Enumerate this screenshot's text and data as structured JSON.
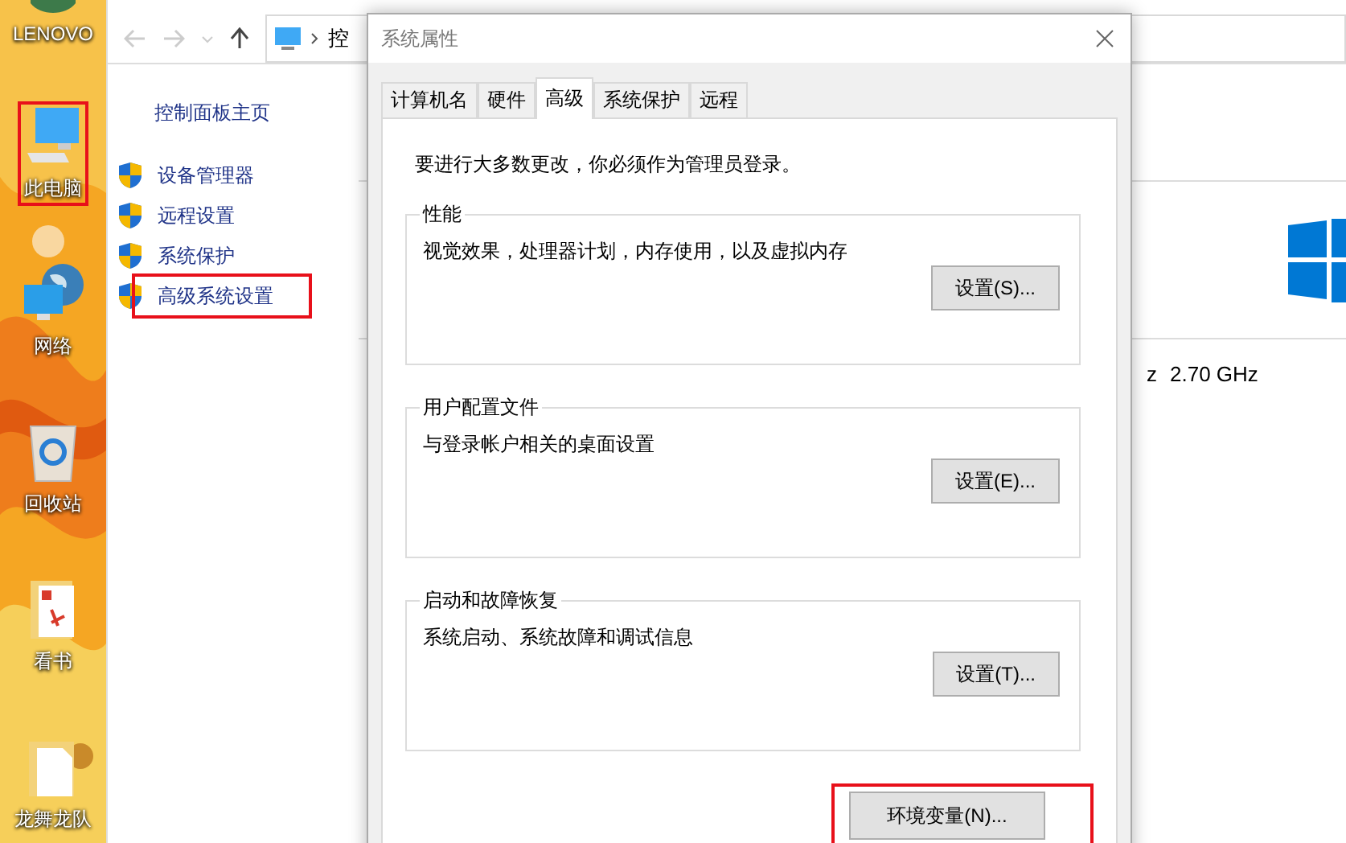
{
  "desktop": {
    "icons": [
      {
        "label": "LENOVO",
        "kind": "user",
        "highlighted": false
      },
      {
        "label": "此电脑",
        "kind": "computer",
        "highlighted": true
      },
      {
        "label": "网络",
        "kind": "network",
        "highlighted": false
      },
      {
        "label": "回收站",
        "kind": "recycle",
        "highlighted": false
      },
      {
        "label": "看书",
        "kind": "pdf",
        "highlighted": false
      },
      {
        "label": "龙舞龙队",
        "kind": "folder",
        "highlighted": false
      }
    ]
  },
  "explorer": {
    "address": "控",
    "nav_title": "控制面板主页",
    "nav_items": [
      {
        "label": "设备管理器",
        "highlighted": false
      },
      {
        "label": "远程设置",
        "highlighted": false
      },
      {
        "label": "系统保护",
        "highlighted": false
      },
      {
        "label": "高级系统设置",
        "highlighted": true
      }
    ],
    "processor_fragment": "z",
    "processor_speed": "2.70 GHz"
  },
  "dialog": {
    "title": "系统属性",
    "tabs": [
      {
        "label": "计算机名",
        "selected": false
      },
      {
        "label": "硬件",
        "selected": false
      },
      {
        "label": "高级",
        "selected": true
      },
      {
        "label": "系统保护",
        "selected": false
      },
      {
        "label": "远程",
        "selected": false
      }
    ],
    "notice": "要进行大多数更改，你必须作为管理员登录。",
    "groups": [
      {
        "title": "性能",
        "description": "视觉效果，处理器计划，内存使用，以及虚拟内存",
        "button": "设置(S)..."
      },
      {
        "title": "用户配置文件",
        "description": "与登录帐户相关的桌面设置",
        "button": "设置(E)..."
      },
      {
        "title": "启动和故障恢复",
        "description": "系统启动、系统故障和调试信息",
        "button": "设置(T)..."
      }
    ],
    "env_button": {
      "label": "环境变量(N)...",
      "highlighted": true
    }
  }
}
